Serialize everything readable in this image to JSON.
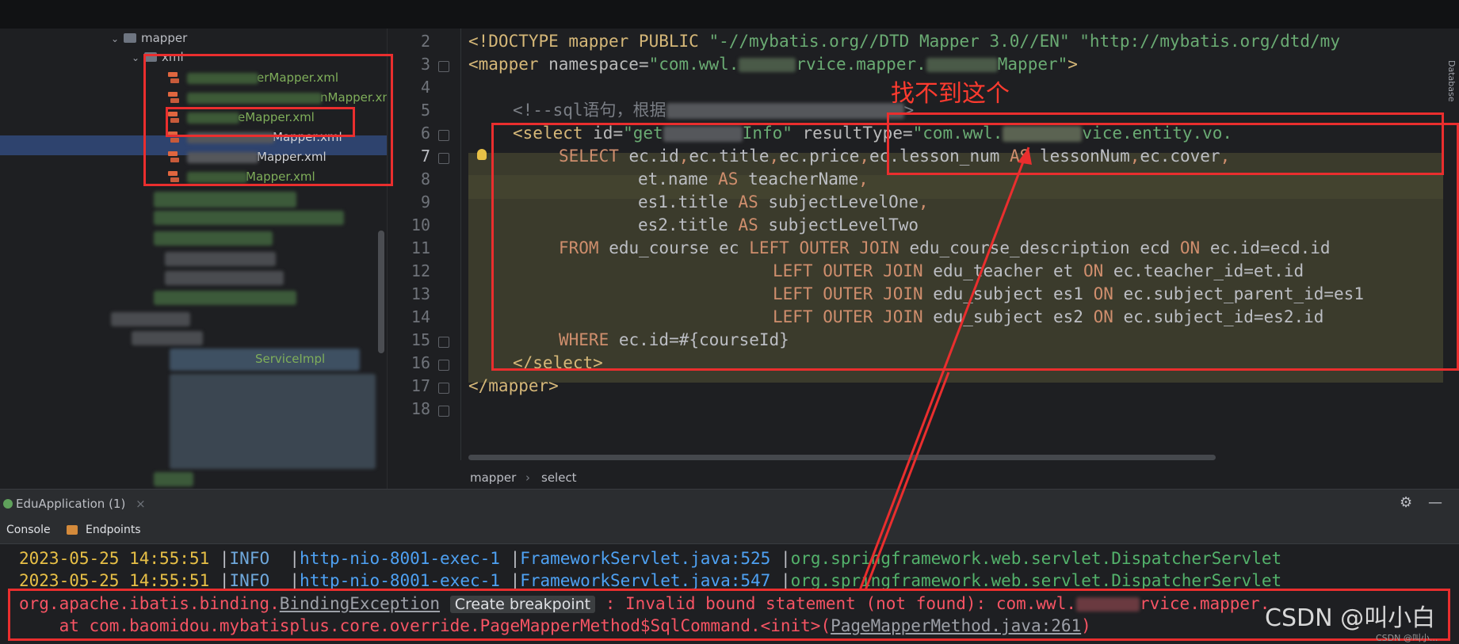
{
  "project_tree": {
    "folder_mapper": "mapper",
    "folder_xml": "xml",
    "files": [
      "erMapper.xml",
      "nMapper.xml",
      "eMapper.xml",
      "Mapper.xml",
      "Mapper.xml",
      "Mapper.xml"
    ],
    "service_impl_fragment": "ServiceImpl"
  },
  "editor": {
    "line_numbers": [
      "2",
      "3",
      "4",
      "5",
      "6",
      "7",
      "8",
      "9",
      "10",
      "11",
      "12",
      "13",
      "14",
      "15",
      "16",
      "17",
      "18"
    ],
    "lines": {
      "l2": {
        "p1": "<!DOCTYPE mapper PUBLIC ",
        "p2": "\"-//mybatis.org//DTD Mapper 3.0//EN\"",
        "p3": " ",
        "p4": "\"http://mybatis.org/dtd/my"
      },
      "l3": {
        "p1": "<mapper ",
        "p2": "namespace=",
        "p3": "\"com.wwl.",
        "p4": "rvice.mapper.",
        "p5": "Mapper\"",
        "p6": ">"
      },
      "l5": {
        "p1": "<!--sql语句，根据"
      },
      "l6": {
        "p1": "<select ",
        "p2": "id=",
        "p3": "\"get",
        "p4": "Info\"",
        "p5": " resultType=",
        "p6": "\"com.wwl.",
        "p7": "vice.entity.vo."
      },
      "l7": {
        "p1": "SELECT ",
        "p2": "ec.id",
        "p3": ",",
        "p4": "ec.title",
        "p5": ",",
        "p6": "ec.price",
        "p7": ",",
        "p8": "ec.lesson_num ",
        "p9": "AS ",
        "p10": "lessonNum",
        "p11": ",",
        "p12": "ec.cover",
        "p13": ","
      },
      "l8": {
        "p1": "et.name ",
        "p2": "AS ",
        "p3": "teacherName",
        "p4": ","
      },
      "l9": {
        "p1": "es1.title ",
        "p2": "AS ",
        "p3": "subjectLevelOne",
        "p4": ","
      },
      "l10": {
        "p1": "es2.title ",
        "p2": "AS ",
        "p3": "subjectLevelTwo"
      },
      "l11": {
        "p1": "FROM ",
        "p2": "edu_course ec ",
        "p3": "LEFT OUTER JOIN ",
        "p4": "edu_course_description ecd ",
        "p5": "ON ",
        "p6": "ec.id=ecd.id"
      },
      "l12": {
        "p1": "LEFT OUTER JOIN ",
        "p2": "edu_teacher et ",
        "p3": "ON ",
        "p4": "ec.teacher_id=et.id"
      },
      "l13": {
        "p1": "LEFT OUTER JOIN ",
        "p2": "edu_subject es1 ",
        "p3": "ON ",
        "p4": "ec.subject_parent_id=es1"
      },
      "l14": {
        "p1": "LEFT OUTER JOIN ",
        "p2": "edu_subject es2 ",
        "p3": "ON ",
        "p4": "ec.subject_id=es2.id"
      },
      "l15": {
        "p1": "WHERE ",
        "p2": "ec.id=#{courseId}"
      },
      "l16": {
        "p1": "</select>"
      },
      "l17": {
        "p1": "</mapper>"
      }
    },
    "breadcrumb": [
      "mapper",
      "select"
    ],
    "breadcrumb_sep": "›",
    "right_tool_label": "Database"
  },
  "run_panel": {
    "tab_label": "EduApplication (1)",
    "close_glyph": "×",
    "settings_glyph": "⚙",
    "minimize_glyph": "—",
    "subtabs": [
      "Console",
      "Endpoints"
    ]
  },
  "console": {
    "line1": {
      "date": "2023-05-25 14:55:51 ",
      "bar": "|",
      "level": "INFO  ",
      "thread": "http-nio-8001-exec-1 ",
      "file": "FrameworkServlet.java:525 ",
      "cls": "org.springframework.web.servlet.DispatcherServlet"
    },
    "line2": {
      "date": "2023-05-25 14:55:51 ",
      "bar": "|",
      "level": "INFO  ",
      "thread": "http-nio-8001-exec-1 ",
      "file": "FrameworkServlet.java:547 ",
      "cls": "org.springframework.web.servlet.DispatcherServlet"
    },
    "line3": {
      "p1": "org.apache.ibatis.binding.",
      "p2": "BindingException",
      "tooltip": "Create breakpoint",
      "p3": " : Invalid bound statement (not found): com.wwl.",
      "p4": "rvice.mapper."
    },
    "line4": {
      "p1": "    at com.baomidou.mybatisplus.core.override.PageMapperMethod$SqlCommand.<init>(",
      "p2": "PageMapperMethod.java:261",
      "p3": ")"
    }
  },
  "annotation": {
    "text": "找不到这个",
    "color": "#ea2e2e"
  },
  "watermark": {
    "main": "CSDN @叫小白",
    "small": "CSDN @叫小..."
  }
}
